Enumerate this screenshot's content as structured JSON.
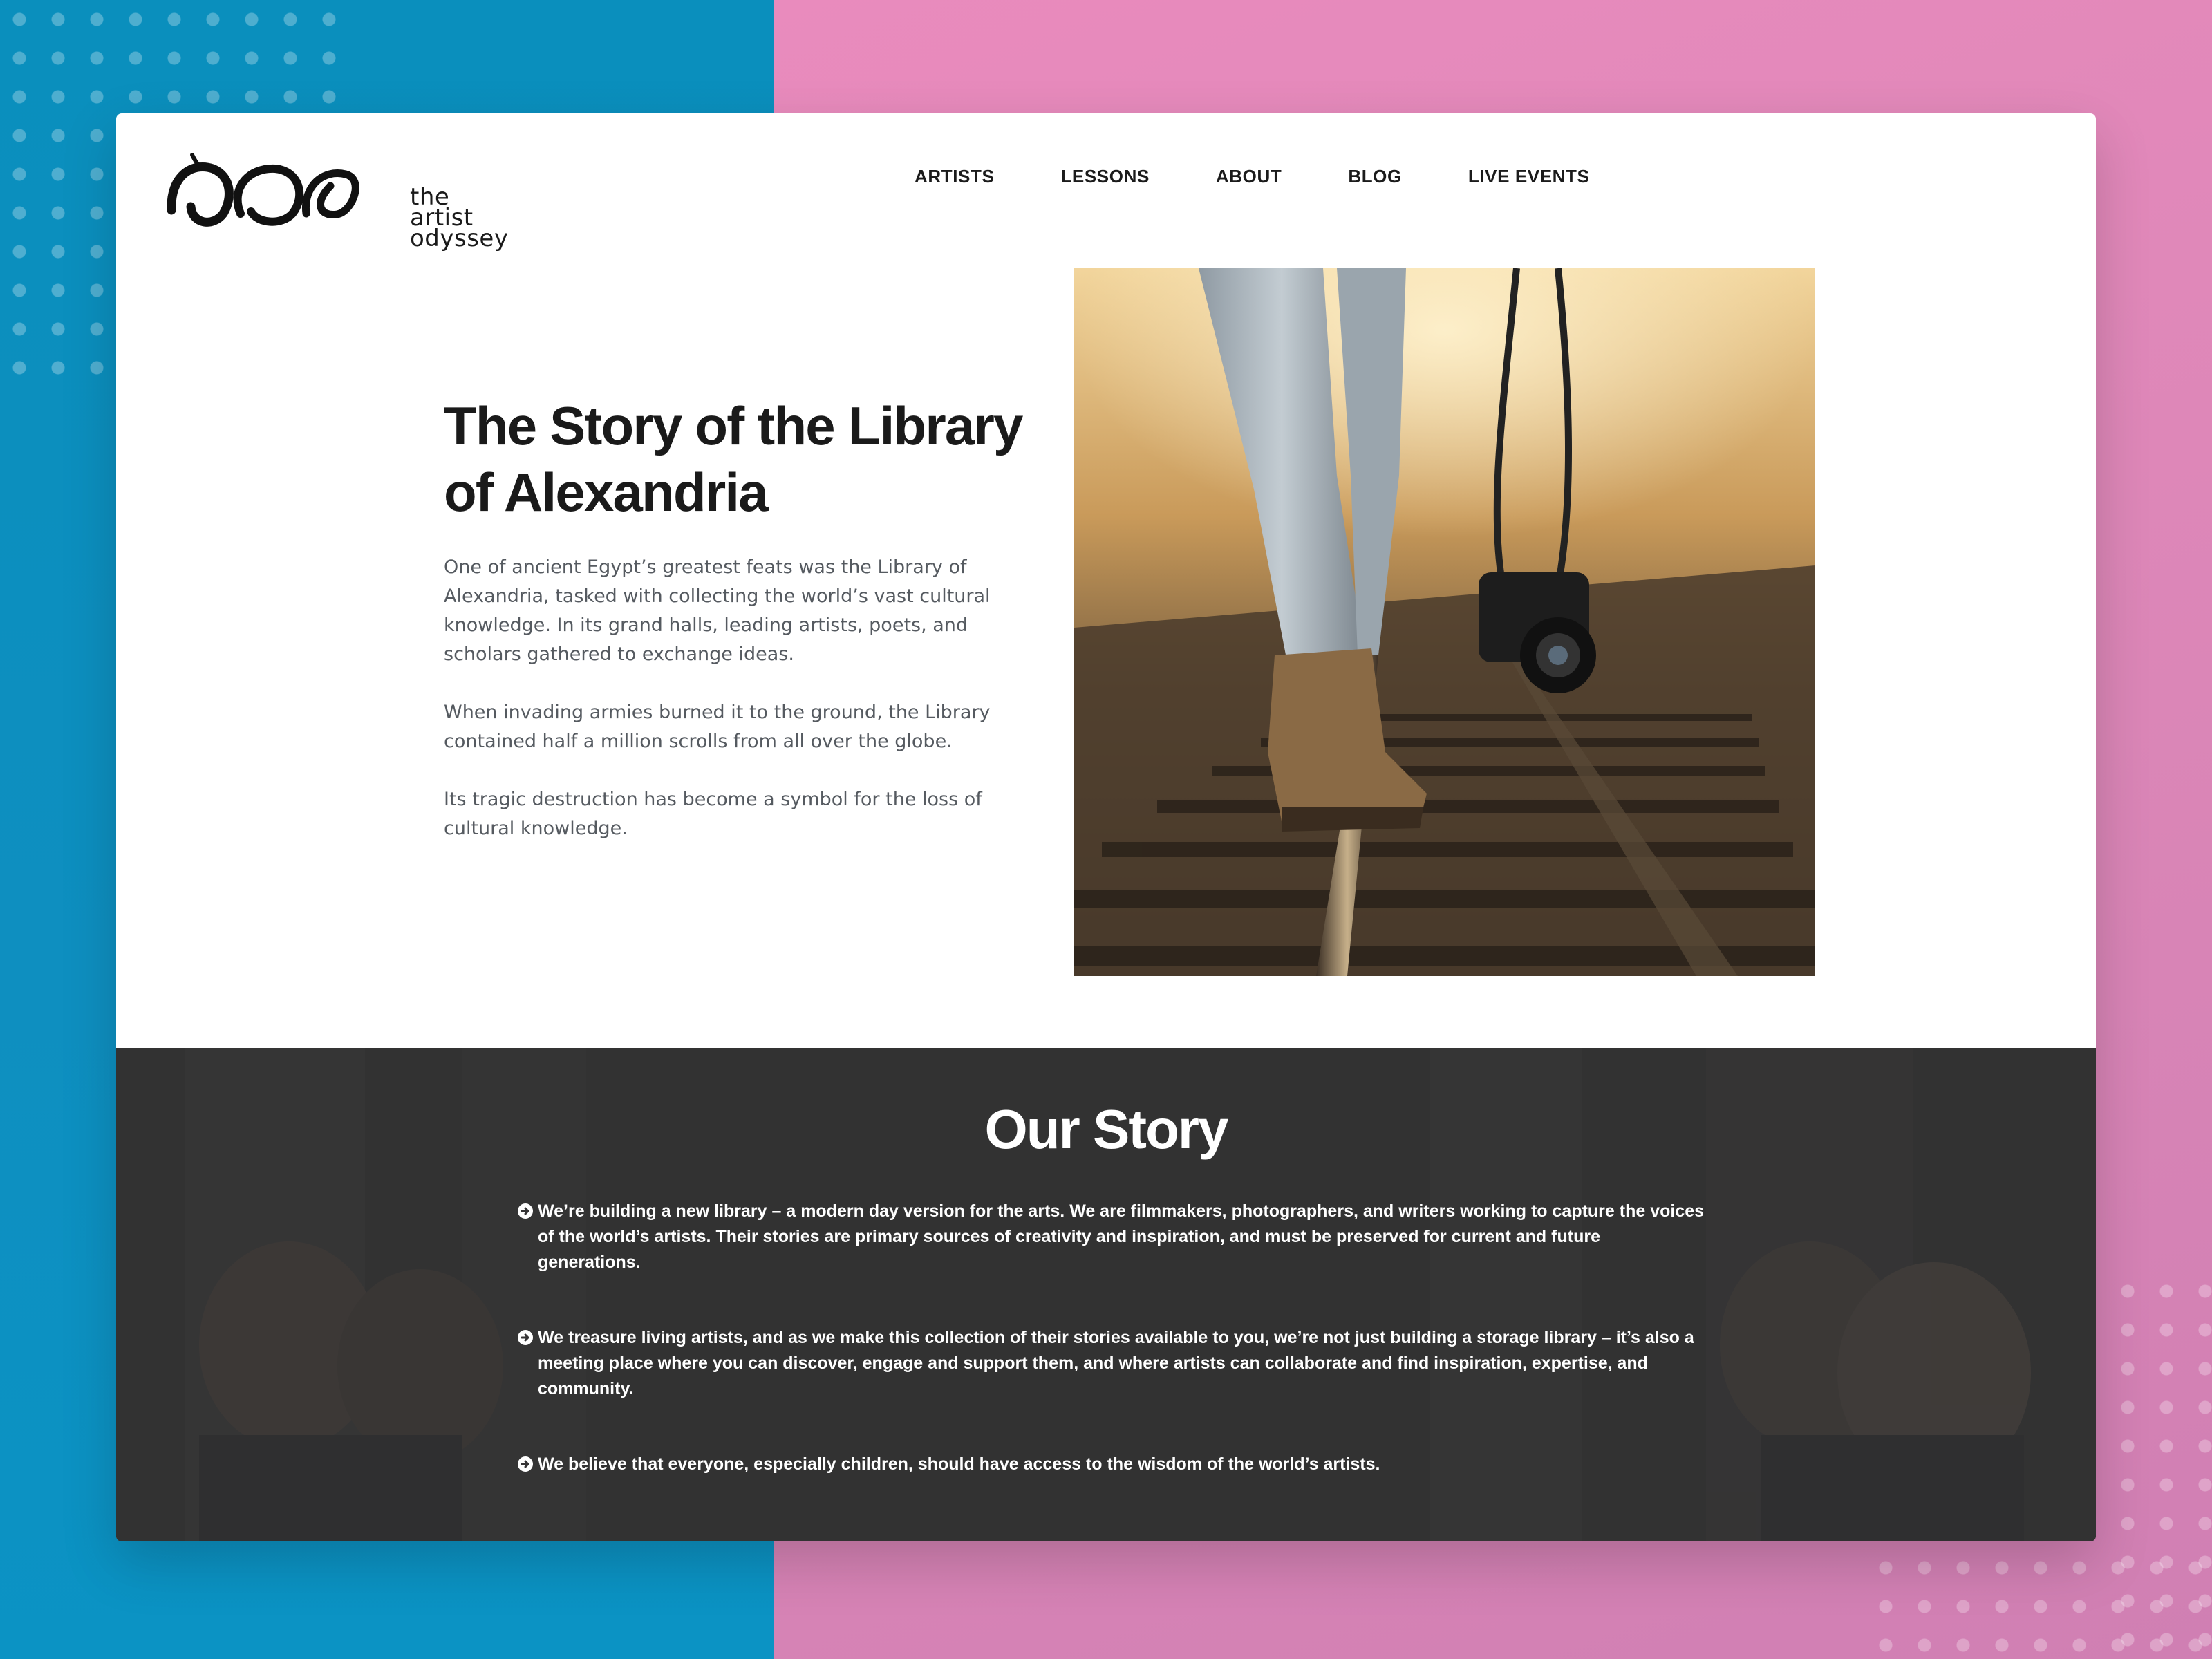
{
  "colors": {
    "bg_left": "#0a8fbd",
    "bg_right": "#e98bbd",
    "card": "#ffffff",
    "story_bg": "#353435",
    "text_dark": "#1a1a1a",
    "text_body": "#555a60"
  },
  "header": {
    "logo": {
      "icon": "artist-odyssey-brush-logo-icon",
      "line1": "the",
      "line2": "artist",
      "line3": "odyssey"
    },
    "nav": [
      {
        "label": "ARTISTS"
      },
      {
        "label": "LESSONS"
      },
      {
        "label": "ABOUT"
      },
      {
        "label": "BLOG"
      },
      {
        "label": "LIVE EVENTS"
      }
    ]
  },
  "hero": {
    "title_line1": "The Story of the Library",
    "title_line2": "of Alexandria",
    "paragraphs": [
      "One of ancient Egypt’s greatest feats was the Library of Alexandria, tasked with collecting the world’s vast cultural knowledge. In its grand halls, leading artists, poets, and scholars gathered to exchange ideas.",
      "When invading armies burned it to the ground, the Library contained half a million scrolls from all over the globe.",
      "Its tragic destruction has become a symbol for the loss of cultural knowledge."
    ]
  },
  "story": {
    "title": "Our Story",
    "bullet_icon": "circle-arrow-right-icon",
    "items": [
      "We’re building a new library – a modern day version for the arts. We are filmmakers, photographers, and writers working to capture the voices of the world’s artists. Their stories are primary sources of creativity and inspiration, and must be preserved for current and future generations.",
      "We treasure living artists, and as we make this collection of their stories available to you, we’re not just building a storage library – it’s also a meeting place where you can discover, engage and support them, and where artists can collaborate and find inspiration, expertise, and community.",
      "We believe that everyone, especially children, should have access to the wisdom of the world’s artists."
    ]
  }
}
